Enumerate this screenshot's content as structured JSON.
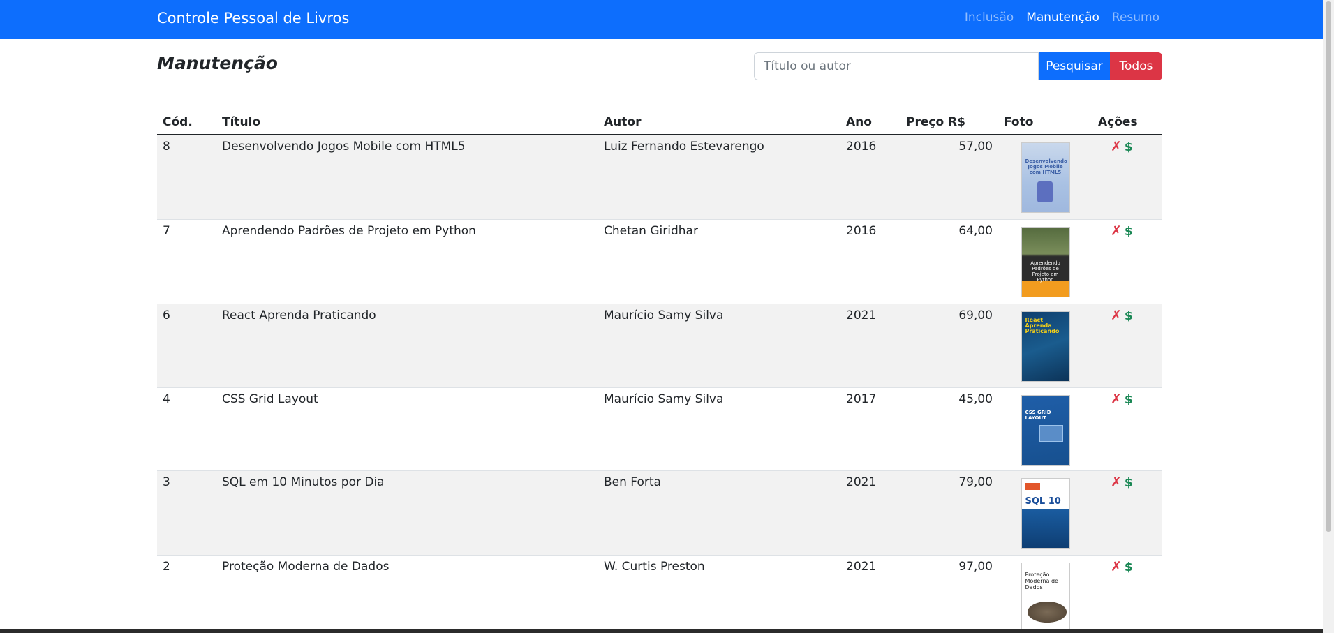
{
  "navbar": {
    "brand": "Controle Pessoal de Livros",
    "links": [
      {
        "label": "Inclusão",
        "active": false
      },
      {
        "label": "Manutenção",
        "active": true
      },
      {
        "label": "Resumo",
        "active": false
      }
    ]
  },
  "page": {
    "title": "Manutenção"
  },
  "search": {
    "placeholder": "Título ou autor",
    "value": "",
    "search_button": "Pesquisar",
    "all_button": "Todos"
  },
  "table": {
    "headers": {
      "code": "Cód.",
      "title": "Título",
      "author": "Autor",
      "year": "Ano",
      "price": "Preço R$",
      "photo": "Foto",
      "actions": "Ações"
    },
    "rows": [
      {
        "code": "8",
        "title": "Desenvolvendo Jogos Mobile com HTML5",
        "author": "Luiz Fernando Estevarengo",
        "year": "2016",
        "price": "57,00",
        "cover_text": "Desenvolvendo Jogos Mobile com HTML5"
      },
      {
        "code": "7",
        "title": "Aprendendo Padrões de Projeto em Python",
        "author": "Chetan Giridhar",
        "year": "2016",
        "price": "64,00",
        "cover_text": "Aprendendo Padrões de Projeto em Python"
      },
      {
        "code": "6",
        "title": "React Aprenda Praticando",
        "author": "Maurício Samy Silva",
        "year": "2021",
        "price": "69,00",
        "cover_text": "React Aprenda Praticando"
      },
      {
        "code": "4",
        "title": "CSS Grid Layout",
        "author": "Maurício Samy Silva",
        "year": "2017",
        "price": "45,00",
        "cover_text": "CSS GRID LAYOUT"
      },
      {
        "code": "3",
        "title": "SQL em 10 Minutos por Dia",
        "author": "Ben Forta",
        "year": "2021",
        "price": "79,00",
        "cover_text": "SQL 10"
      },
      {
        "code": "2",
        "title": "Proteção Moderna de Dados",
        "author": "W. Curtis Preston",
        "year": "2021",
        "price": "97,00",
        "cover_text": "Proteção Moderna de Dados"
      }
    ],
    "action_delete": "✗",
    "action_buy": "$"
  },
  "colors": {
    "primary": "#0d6efd",
    "danger": "#dc3545",
    "success": "#198754",
    "stripe": "#f2f2f2"
  }
}
